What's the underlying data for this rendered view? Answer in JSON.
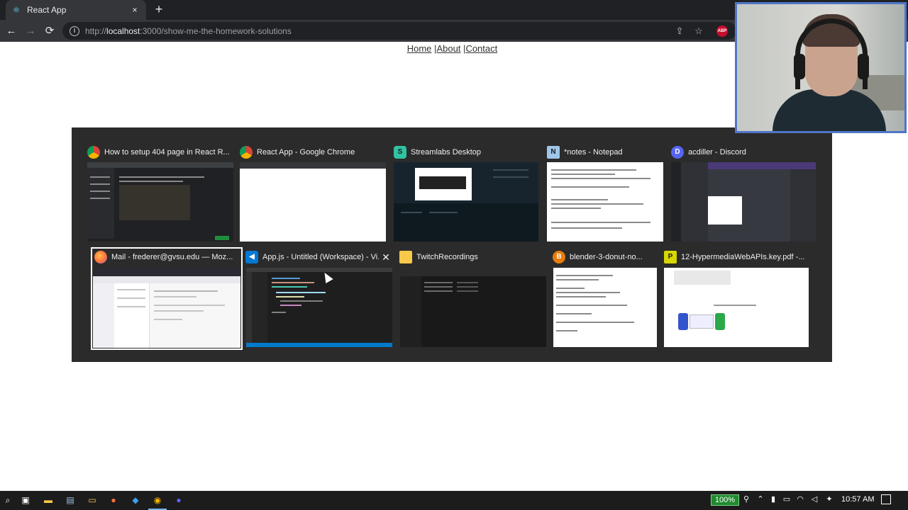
{
  "browser": {
    "tab_title": "React App",
    "tab_close": "×",
    "new_tab": "+",
    "back": "←",
    "forward": "→",
    "reload": "⟳",
    "url_prefix": "http://",
    "url_host": "localhost",
    "url_rest": ":3000/show-me-the-homework-solutions",
    "share_icon": "share-icon",
    "star_icon": "☆",
    "extension_badge": "ABP"
  },
  "page": {
    "nav": [
      {
        "label": "Home"
      },
      {
        "sep": "|"
      },
      {
        "label": "About"
      },
      {
        "sep": "|"
      },
      {
        "label": "Contact"
      }
    ]
  },
  "switcher": {
    "windows": [
      {
        "title": "How to setup 404 page in React R...",
        "icon": "chrome-icon"
      },
      {
        "title": "React App - Google Chrome",
        "icon": "chrome-icon"
      },
      {
        "title": "Streamlabs Desktop",
        "icon": "streamlabs-icon"
      },
      {
        "title": "*notes - Notepad",
        "icon": "notepad-icon"
      },
      {
        "title": "acdiller - Discord",
        "icon": "discord-icon"
      },
      {
        "title": "Mail - frederer@gvsu.edu — Moz...",
        "icon": "firefox-icon"
      },
      {
        "title": "App.js - Untitled (Workspace) - Vi...",
        "icon": "vscode-icon",
        "close": "✕"
      },
      {
        "title": "TwitchRecordings",
        "icon": "folder-icon"
      },
      {
        "title": "blender-3-donut-no...",
        "icon": "blender-icon"
      },
      {
        "title": "12-HypermediaWebAPIs.key.pdf -...",
        "icon": "pdf-icon"
      }
    ]
  },
  "taskbar": {
    "battery": "100%",
    "clock": "10:57 AM"
  }
}
